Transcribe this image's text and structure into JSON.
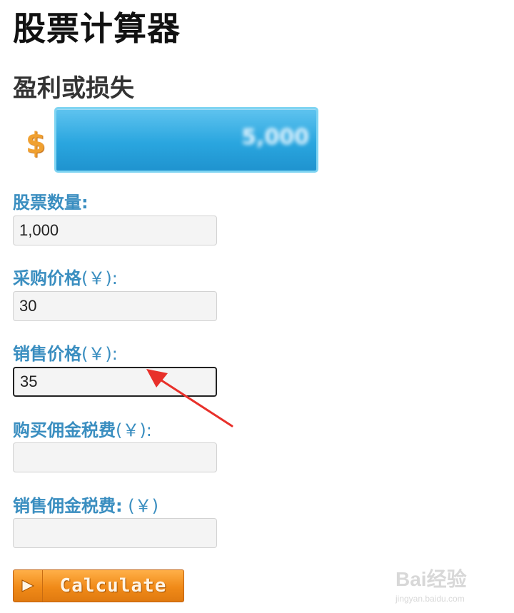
{
  "page": {
    "title": "股票计算器"
  },
  "result": {
    "heading": "盈利或损失",
    "currency_symbol": "$",
    "value": "5,000"
  },
  "fields": [
    {
      "label": "股票数量:",
      "unit": "",
      "value": "1,000",
      "placeholder": ""
    },
    {
      "label": "采购价格",
      "unit": "(￥):",
      "value": "30",
      "placeholder": ""
    },
    {
      "label": "销售价格",
      "unit": "(￥):",
      "value": "35",
      "placeholder": ""
    },
    {
      "label": "购买佣金税费",
      "unit": "(￥):",
      "value": "",
      "placeholder": ""
    },
    {
      "label": "销售佣金税费:",
      "unit": " (￥)",
      "value": "",
      "placeholder": ""
    }
  ],
  "button": {
    "label": "Calculate",
    "icon": "play-arrow-icon"
  },
  "watermark": {
    "main": "Bai经验",
    "sub": "jingyan.baidu.com"
  },
  "colors": {
    "label": "#3a8ec0",
    "result_box": "#2aa6df",
    "button": "#f08a18",
    "arrow": "#e8302a"
  }
}
